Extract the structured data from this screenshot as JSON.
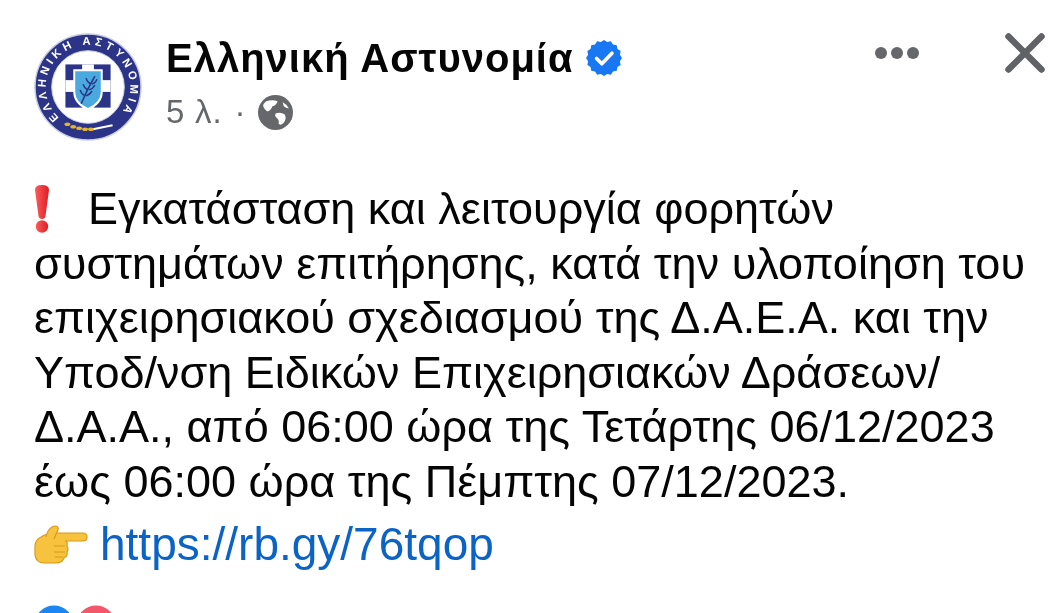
{
  "header": {
    "logo_text": "ΕΛΛΗΝΙΚΗ ΑΣΤΥΝΟΜΙΑ",
    "page_name": "Ελληνική Αστυνομία",
    "verified": true,
    "time": "5 λ.",
    "separator": "·"
  },
  "post": {
    "text_lines": [
      "Εγκατάσταση και λειτουργία φορητών",
      "συστημάτων επιτήρησης, κατά την υλοποίηση του",
      "επιχειρησιακού σχεδιασμού της Δ.Α.Ε.Α. και την",
      "Υποδ/νση Ειδικών Επιχειρησιακών Δράσεων/",
      "Δ.Α.Α., από 06:00 ώρα της Τετάρτης 06/12/2023",
      "έως 06:00 ώρα της Πέμπτης 07/12/2023."
    ],
    "link": "https://rb.gy/76tqop"
  },
  "reactions": [
    {
      "kind": "like"
    },
    {
      "kind": "love"
    }
  ]
}
